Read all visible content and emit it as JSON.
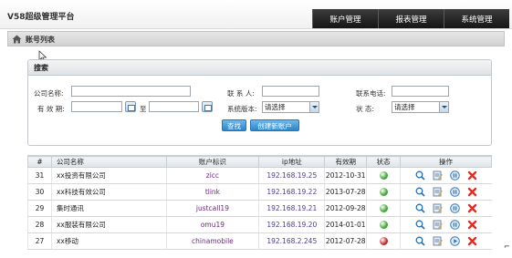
{
  "app": {
    "title": "V58超级管理平台"
  },
  "nav": [
    {
      "label": "账户管理"
    },
    {
      "label": "报表管理"
    },
    {
      "label": "系统管理"
    }
  ],
  "page": {
    "title": "账号列表"
  },
  "search": {
    "title": "搜索",
    "labels": {
      "company": "公司名称:",
      "contact": "联 系 人:",
      "phone": "联系电话:",
      "valid": "有 效 期:",
      "to": "至",
      "version": "系统版本:",
      "status": "状    态:"
    },
    "version_selected": "请选择",
    "status_selected": "请选择",
    "search_button": "查找",
    "create_button": "创建新账户"
  },
  "table": {
    "columns": [
      "#",
      "公司名称",
      "账户标识",
      "ip地址",
      "有效期",
      "状态",
      "操作"
    ],
    "rows": [
      {
        "id": "31",
        "company": "xx投资有限公司",
        "ident": "zicc",
        "ip": "192.168.19.25",
        "expiry": "2012-10-31",
        "status": "green",
        "action": "pause"
      },
      {
        "id": "30",
        "company": "xx科技有效公司",
        "ident": "tlink",
        "ip": "192.168.19.22",
        "expiry": "2013-07-28",
        "status": "green",
        "action": "pause"
      },
      {
        "id": "29",
        "company": "集时通讯",
        "ident": "justcall19",
        "ip": "192.168.19.21",
        "expiry": "2012-09-28",
        "status": "green",
        "action": "pause"
      },
      {
        "id": "28",
        "company": "xx服装有限公司",
        "ident": "omu19",
        "ip": "192.168.19.20",
        "expiry": "2014-01-01",
        "status": "green",
        "action": "pause"
      },
      {
        "id": "27",
        "company": "xx移动",
        "ident": "chinamobile",
        "ip": "192.168.2.245",
        "expiry": "2012-07-28",
        "status": "red",
        "action": "play"
      }
    ]
  },
  "colors": {
    "status_green": "#3fa535",
    "status_red": "#c0262b",
    "nav_bg": "#1c1c1c",
    "button": "#3a93d2"
  },
  "icons": {
    "ops": [
      "search-icon",
      "edit-icon",
      "pause-icon",
      "delete-icon"
    ]
  }
}
